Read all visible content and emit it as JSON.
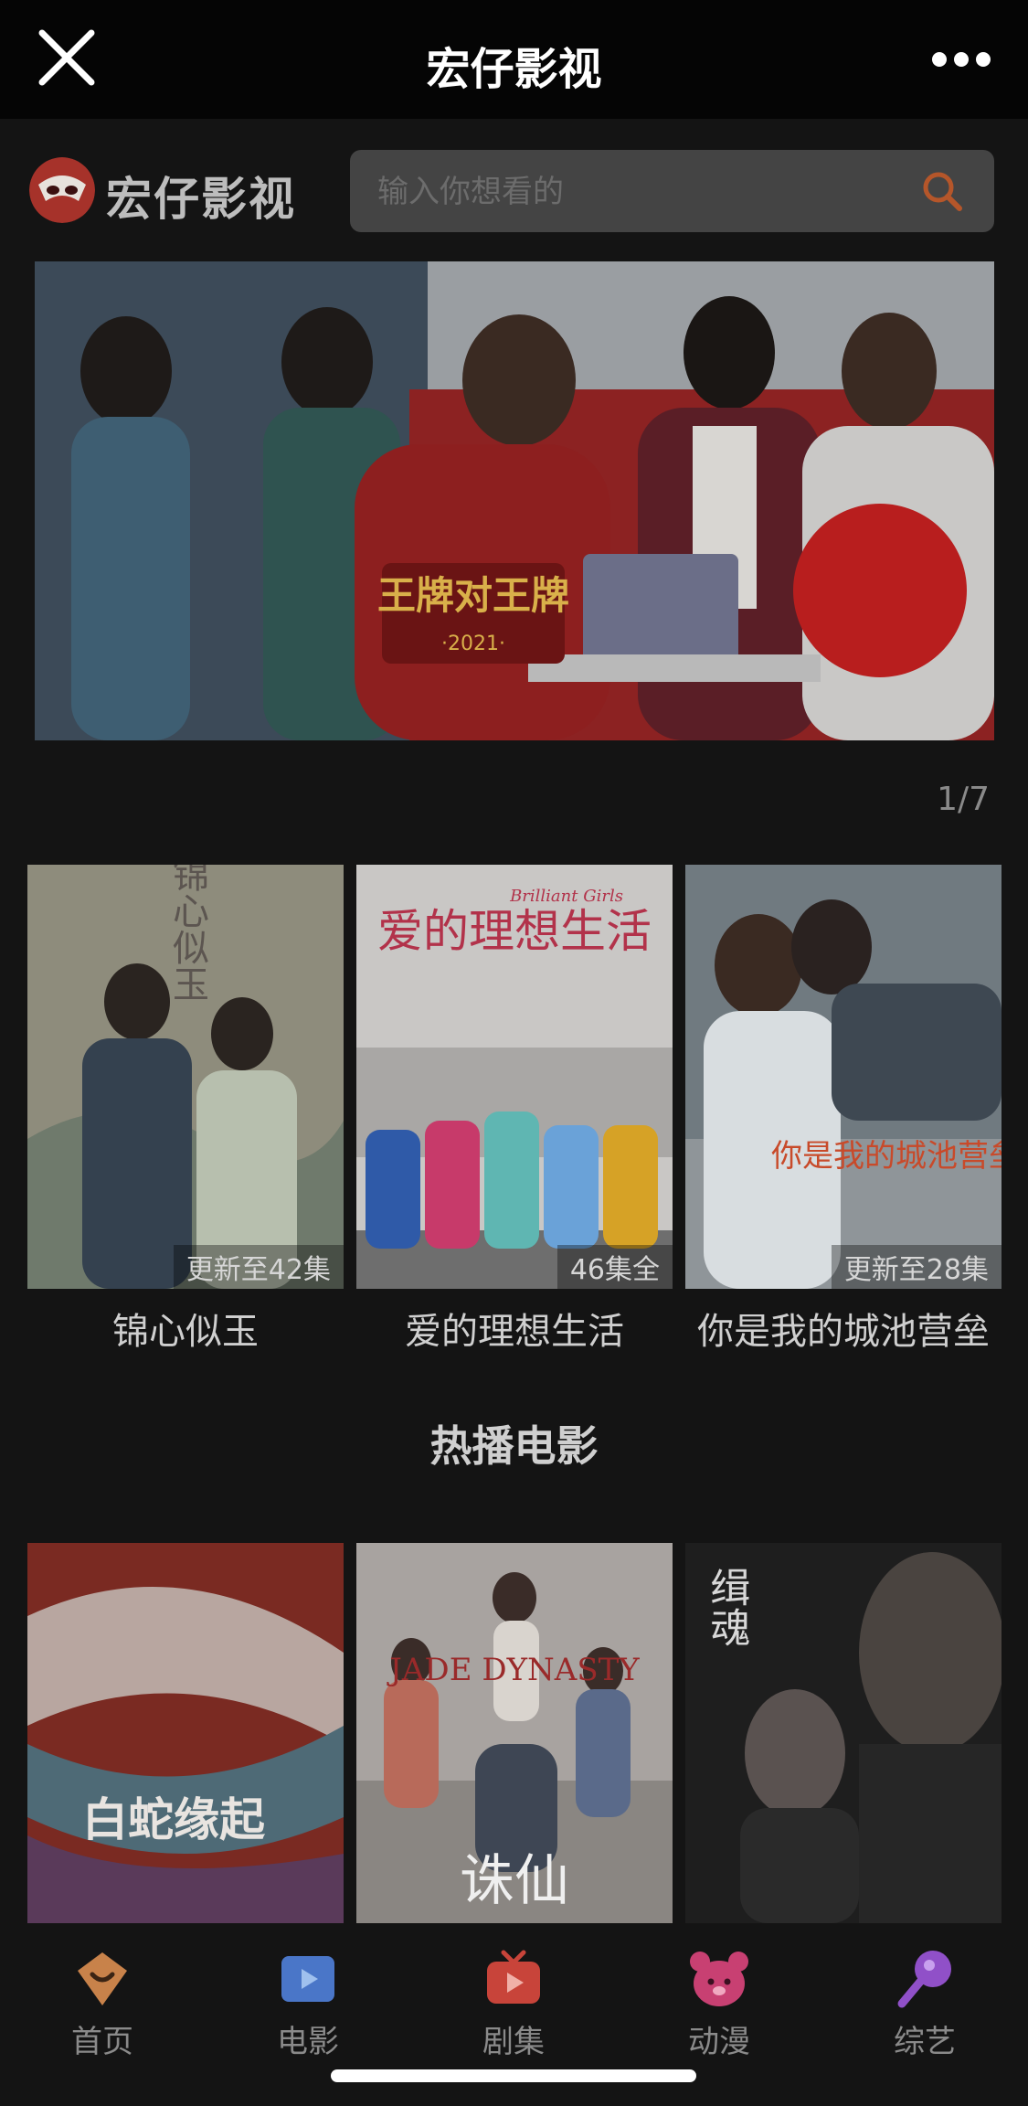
{
  "topbar": {
    "title": "宏仔影视"
  },
  "logo": {
    "text": "宏仔影视"
  },
  "search": {
    "placeholder": "输入你想看的"
  },
  "banner": {
    "caption": "王牌对王牌",
    "year": "·2021·",
    "pager": "1/7"
  },
  "series": [
    {
      "title": "锦心似玉",
      "badge": "更新至42集",
      "poster_text": "锦心似玉"
    },
    {
      "title": "爱的理想生活",
      "badge": "46集全",
      "poster_text": "爱的理想生活",
      "poster_sub": "Brilliant Girls"
    },
    {
      "title": "你是我的城池营垒",
      "badge": "更新至28集",
      "poster_text": "你是我的城池营垒"
    }
  ],
  "hot_movies": {
    "heading": "热播电影",
    "items": [
      {
        "poster_text": "白蛇缘起"
      },
      {
        "poster_text": "JADE DYNASTY",
        "poster_sub": "诛仙"
      },
      {
        "poster_text": "缉魂"
      }
    ]
  },
  "tabs": [
    {
      "label": "首页",
      "icon": "home-icon",
      "color": "#d6894a"
    },
    {
      "label": "电影",
      "icon": "film-icon",
      "color": "#4a7bd6"
    },
    {
      "label": "剧集",
      "icon": "tv-icon",
      "color": "#d6493e"
    },
    {
      "label": "动漫",
      "icon": "bear-icon",
      "color": "#d6457a"
    },
    {
      "label": "综艺",
      "icon": "mic-icon",
      "color": "#9a55d6"
    }
  ]
}
